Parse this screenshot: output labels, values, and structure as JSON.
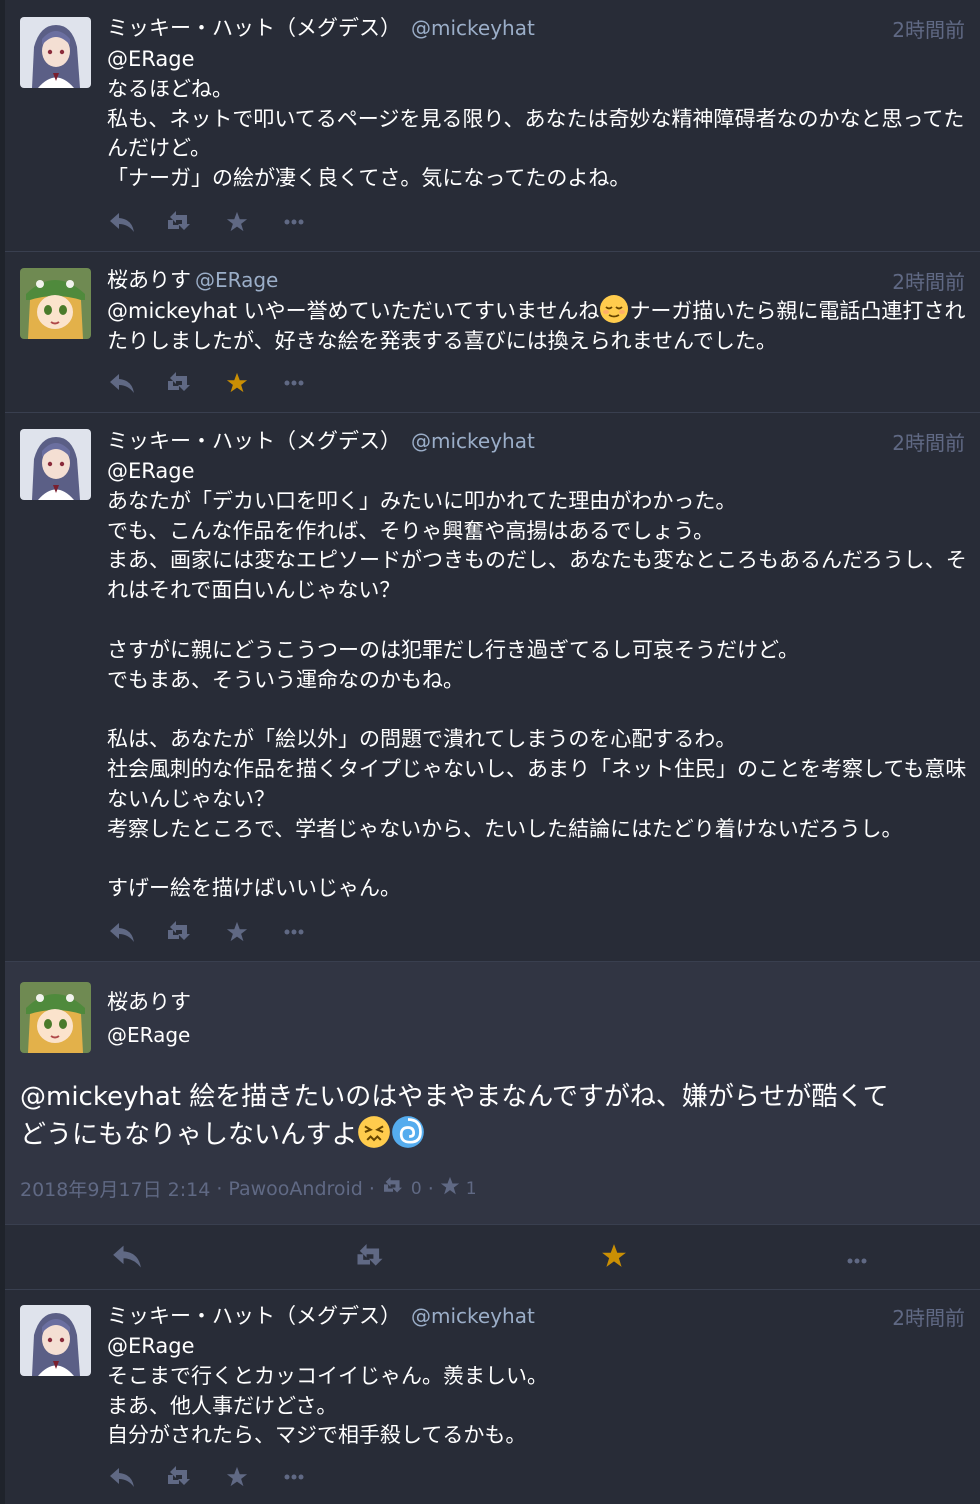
{
  "statuses": [
    {
      "display_name": "ミッキー・ハット（メグデス）",
      "acct": "@mickeyhat",
      "time": "2時間前",
      "body": "@ERage\nなるほどね。\n私も、ネットで叩いてるページを見る限り、あなたは奇妙な精神障碍者なのかなと思ってたんだけど。\n「ナーガ」の絵が凄く良くてさ。気になってたのよね。",
      "favourited": false
    },
    {
      "display_name": "桜ありす",
      "acct": "@ERage",
      "time": "2時間前",
      "body_before_emoji": "@mickeyhat いやー誉めていただいてすいませんね",
      "body_after_emoji": "ナーガ描いたら親に電話凸連打されたりしましたが、好きな絵を発表する喜びには換えられませんでした。",
      "emoji": "relieved-face-emoji",
      "favourited": true
    },
    {
      "display_name": "ミッキー・ハット（メグデス）",
      "acct": "@mickeyhat",
      "time": "2時間前",
      "body": "@ERage\nあなたが「デカい口を叩く」みたいに叩かれてた理由がわかった。\nでも、こんな作品を作れば、そりゃ興奮や高揚はあるでしょう。\nまあ、画家には変なエピソードがつきものだし、あなたも変なところもあるんだろうし、それはそれで面白いんじゃない？\n\nさすがに親にどうこうつーのは犯罪だし行き過ぎてるし可哀そうだけど。\nでもまあ、そういう運命なのかもね。\n\n私は、あなたが「絵以外」の問題で潰れてしまうのを心配するわ。\n社会風刺的な作品を描くタイプじゃないし、あまり「ネット住民」のことを考察しても意味ないんじゃない？\n考察したところで、学者じゃないから、たいした結論にはたどり着けないだろうし。\n\nすげー絵を描けばいいじゃん。",
      "favourited": false
    },
    {
      "display_name": "ミッキー・ハット（メグデス）",
      "acct": "@mickeyhat",
      "time": "2時間前",
      "body": "@ERage\nそこまで行くとカッコイイじゃん。羨ましい。\nまあ、他人事だけどさ。\n自分がされたら、マジで相手殺してるかも。",
      "favourited": false
    }
  ],
  "detailed": {
    "display_name": "桜ありす",
    "acct": "@ERage",
    "body_line1": "@mickeyhat 絵を描きたいのはやまやまなんですがね、嫌がらせが酷くて",
    "body_line2": "どうにもなりゃしないんすよ",
    "emojis": [
      "confounded-face-emoji",
      "cyclone-emoji"
    ],
    "datetime": "2018年9月17日 2:14",
    "application": "PawooAndroid",
    "reblogs_count": "0",
    "favourites_count": "1",
    "favourited": true
  },
  "colors": {
    "background": "#282c37",
    "detailed_background": "#313543",
    "muted": "#606984",
    "acct": "#9baec8",
    "favourite_active": "#ca8f04"
  },
  "icons": [
    "reply-icon",
    "boost-icon",
    "star-icon",
    "more-icon"
  ]
}
